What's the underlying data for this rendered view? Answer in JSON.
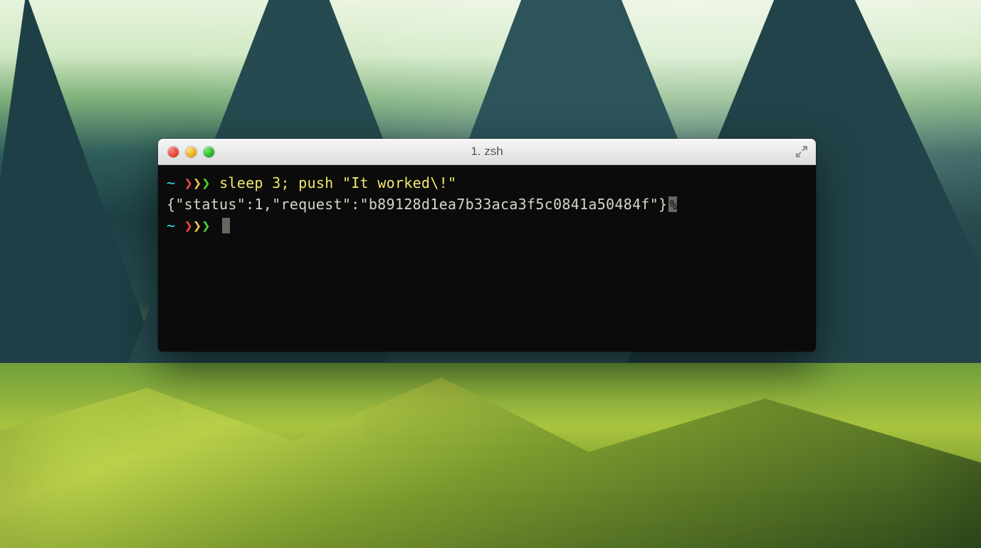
{
  "window": {
    "title": "1. zsh"
  },
  "terminal": {
    "prompt": {
      "tilde": "~",
      "chevrons": "❯❯❯"
    },
    "line1_cmd": "sleep 3;",
    "line1_push": "push",
    "line1_arg": "\"It worked\\!\"",
    "line2_output": "{\"status\":1,\"request\":\"b89128d1ea7b33aca3f5c0841a50484f\"}"
  }
}
